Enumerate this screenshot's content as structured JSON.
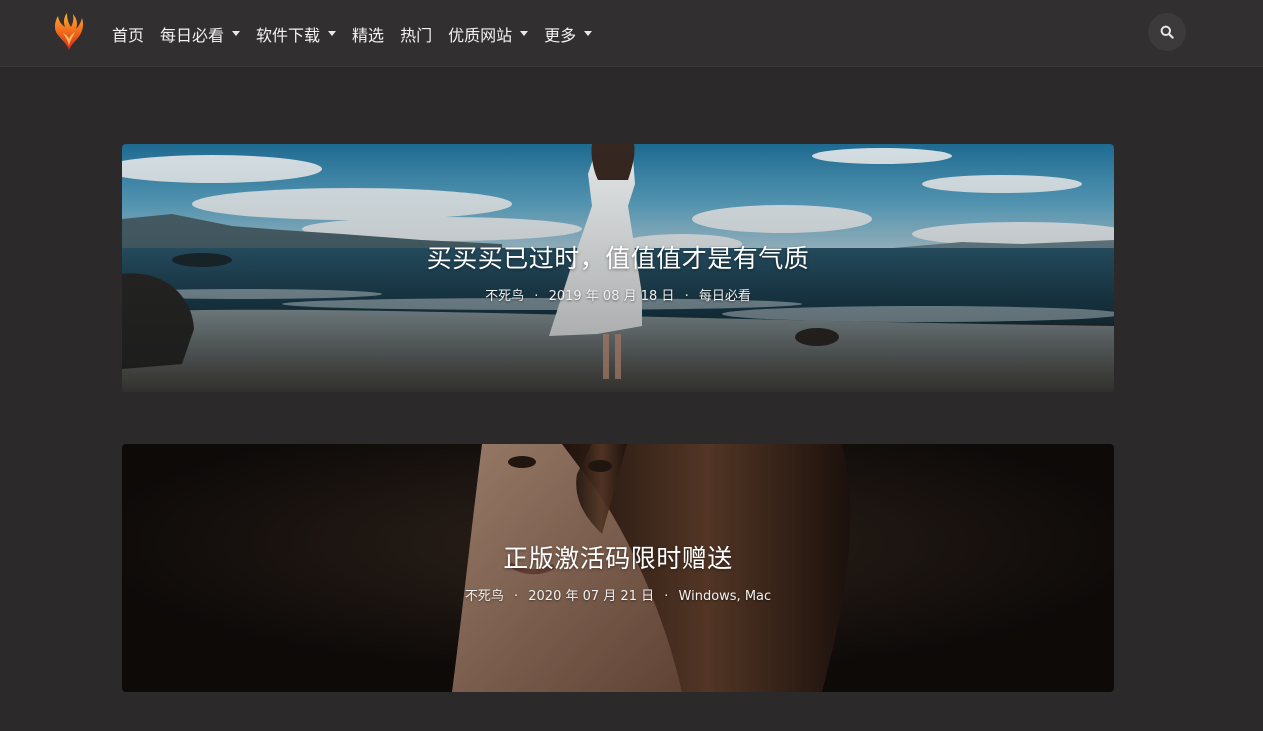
{
  "nav": {
    "logo_icon": "phoenix-logo",
    "items": [
      {
        "label": "首页",
        "dropdown": false
      },
      {
        "label": "每日必看",
        "dropdown": true
      },
      {
        "label": "软件下载",
        "dropdown": true
      },
      {
        "label": "精选",
        "dropdown": false
      },
      {
        "label": "热门",
        "dropdown": false
      },
      {
        "label": "优质网站",
        "dropdown": true
      },
      {
        "label": "更多",
        "dropdown": true
      }
    ],
    "search_icon": "search-icon"
  },
  "posts": [
    {
      "title": "买买买已过时，值值值才是有气质",
      "author": "不死鸟",
      "date": "2019 年 08 月 18 日",
      "category": "每日必看",
      "separator": "·"
    },
    {
      "title": "正版激活码限时赠送",
      "author": "不死鸟",
      "date": "2020 年 07 月 21 日",
      "category": "Windows, Mac",
      "separator": "·"
    }
  ],
  "colors": {
    "page_bg": "#2b292a",
    "navbar_bg": "#312f30",
    "logo_orange": "#f26a1b"
  }
}
